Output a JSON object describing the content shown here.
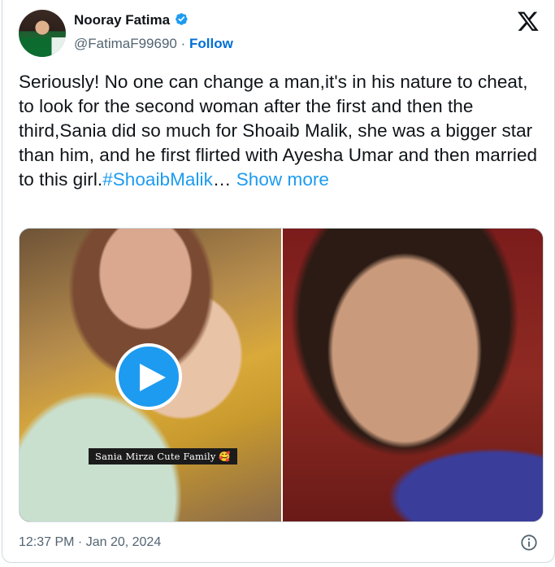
{
  "author": {
    "name": "Nooray Fatima",
    "handle": "@FatimaF99690",
    "separator": "·",
    "follow_label": "Follow",
    "verified_icon": "verified-badge-icon",
    "verified_color": "#1d9bf0"
  },
  "platform_icon": "x-logo-icon",
  "tweet": {
    "text": "Seriously! No one can change a man,it's in his nature to cheat, to look for the second woman after the first and then the third,Sania did so much for Shoaib Malik, she was a bigger star than him, and he first flirted with Ayesha Umar and then married to this girl.",
    "hashtag": "#ShoaibMalik",
    "ellipsis": "…",
    "show_more": "Show more"
  },
  "media": {
    "left_caption": "Sania Mirza Cute Family 🥰",
    "play_icon": "play-icon",
    "play_color": "#1d9bf0"
  },
  "footer": {
    "timestamp": "12:37 PM · Jan 20, 2024",
    "info_icon": "info-icon"
  },
  "colors": {
    "text": "#0f1419",
    "secondary": "#536471",
    "link": "#1d9bf0",
    "follow": "#006fd6",
    "border": "#cfd9de"
  }
}
